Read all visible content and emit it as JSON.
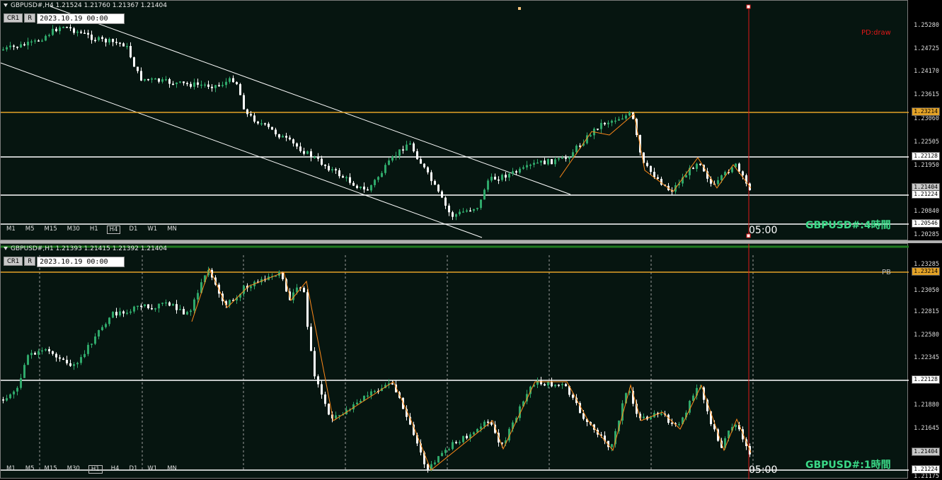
{
  "colors": {
    "bg": "#061510",
    "bull": "#2fa86a",
    "bear": "#ffffff",
    "hline": "#ffffff",
    "orange_line": "#e3a227",
    "zigzag": "#ff8a1a",
    "vline": "#e01818",
    "grid": "#9a9a9a",
    "title": "#3ad987"
  },
  "top": {
    "header": "GBPUSD#,H4  1.21524 1.21760 1.21367 1.21404",
    "btn_cr": "CR1",
    "btn_r": "R",
    "date_value": "2023.10.19 00:00",
    "timeframes": [
      "M1",
      "M5",
      "M15",
      "M30",
      "H1",
      "H4",
      "D1",
      "W1",
      "MN"
    ],
    "active_tf": "H4",
    "ticks": [
      "1.25280",
      "1.24725",
      "1.24170",
      "1.23615",
      "1.23060",
      "1.22505",
      "1.21950",
      "1.20840",
      "1.20285"
    ],
    "price_labels": [
      {
        "text": "1.23214",
        "style": "orange"
      },
      {
        "text": "1.22128",
        "style": "white"
      },
      {
        "text": "1.21404",
        "style": "grey"
      },
      {
        "text": "1.21224",
        "style": "white"
      },
      {
        "text": "1.20546",
        "style": "white"
      }
    ],
    "pd_label": "PD:draw",
    "title": "GBPUSD#:4時間",
    "time_label": "05:00"
  },
  "bottom": {
    "header": "GBPUSD#,H1  1.21393 1.21415 1.21392 1.21404",
    "btn_cr": "CR1",
    "btn_r": "R",
    "date_value": "2023.10.19 00:00",
    "timeframes": [
      "M1",
      "M5",
      "M15",
      "M30",
      "H1",
      "H4",
      "D1",
      "W1",
      "MN"
    ],
    "active_tf": "H1",
    "ticks": [
      "1.23285",
      "1.23050",
      "1.22815",
      "1.22580",
      "1.22345",
      "1.21880",
      "1.21645",
      "1.21175"
    ],
    "price_labels": [
      {
        "text": "1.23214",
        "style": "orange"
      },
      {
        "text": "1.22128",
        "style": "white"
      },
      {
        "text": "1.21404",
        "style": "grey"
      },
      {
        "text": "1.21224",
        "style": "white"
      }
    ],
    "pb_label": "PB",
    "title": "GBPUSD#:1時間",
    "time_label": "05:00"
  }
}
